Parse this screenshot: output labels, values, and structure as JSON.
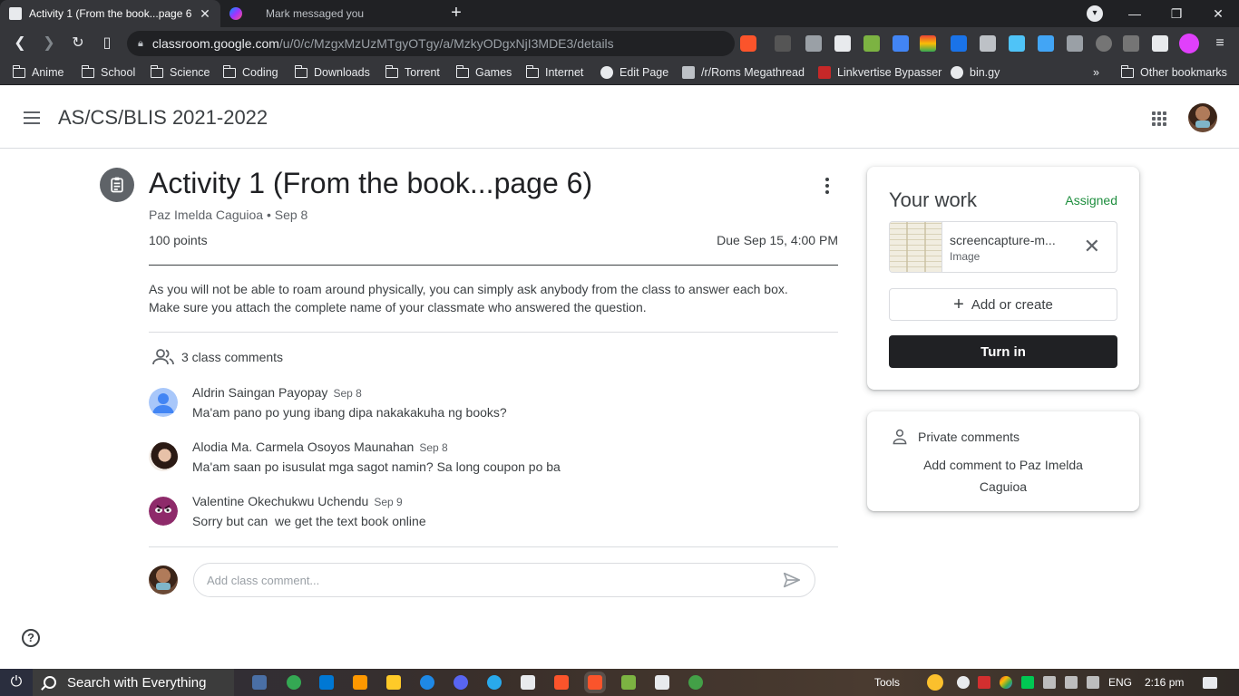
{
  "browser": {
    "tabs": [
      {
        "title": "Activity 1 (From the book...page 6",
        "active": true
      },
      {
        "title": "Mark messaged you",
        "active": false
      }
    ],
    "new_tab_label": "+",
    "window_controls": {
      "minimize": "—",
      "restore": "❐",
      "close": "✕"
    },
    "url_domain": "classroom.google.com",
    "url_path": "/u/0/c/MzgxMzUzMTgyOTgy/a/MzkyODgxNjI3MDE3/details",
    "brave_badge": "7"
  },
  "bookmarks": [
    {
      "label": "Anime",
      "type": "folder"
    },
    {
      "label": "School",
      "type": "folder"
    },
    {
      "label": "Science",
      "type": "folder"
    },
    {
      "label": "Coding",
      "type": "folder"
    },
    {
      "label": "Downloads",
      "type": "folder"
    },
    {
      "label": "Torrent",
      "type": "folder"
    },
    {
      "label": "Games",
      "type": "folder"
    },
    {
      "label": "Internet",
      "type": "folder"
    },
    {
      "label": "Edit Page",
      "type": "link"
    },
    {
      "label": "/r/Roms Megathread",
      "type": "link"
    },
    {
      "label": "Linkvertise Bypasser",
      "type": "link"
    },
    {
      "label": "bin.gy",
      "type": "link"
    }
  ],
  "bookmarks_overflow": "»",
  "other_bookmarks": "Other bookmarks",
  "classroom": {
    "class_name": "AS/CS/BLIS 2021-2022"
  },
  "assignment": {
    "title": "Activity 1 (From the book...page 6)",
    "meta": "Paz Imelda Caguioa • Sep 8",
    "points": "100 points",
    "due": "Due Sep 15, 4:00 PM",
    "description_line1": "As you will not be able to roam around physically, you can simply ask anybody from the class to answer each box.",
    "description_line2": "Make sure you attach the complete name of your classmate who answered the question."
  },
  "comments": {
    "header": "3 class comments",
    "items": [
      {
        "name": "Aldrin Saingan Payopay",
        "date": "Sep 8",
        "text": "Ma'am pano po yung ibang dipa nakakakuha ng books?"
      },
      {
        "name": "Alodia Ma. Carmela Osoyos Maunahan",
        "date": "Sep 8",
        "text": "Ma'am saan po isusulat mga sagot namin? Sa long coupon po ba"
      },
      {
        "name": "Valentine Okechukwu Uchendu",
        "date": "Sep 9",
        "text": "Sorry but can  we get the text book online"
      }
    ],
    "input_placeholder": "Add class comment..."
  },
  "your_work": {
    "title": "Your work",
    "status": "Assigned",
    "status_color": "#1e8e3e",
    "attachment_name": "screencapture-m...",
    "attachment_type": "Image",
    "add_create_label": "Add or create",
    "turn_in_label": "Turn in"
  },
  "private_comments": {
    "header": "Private comments",
    "add_label": "Add comment to Paz Imelda Caguioa"
  },
  "taskbar": {
    "search_label": "Search with Everything",
    "tools_label": "Tools",
    "language": "ENG",
    "time": "2:16 pm"
  }
}
